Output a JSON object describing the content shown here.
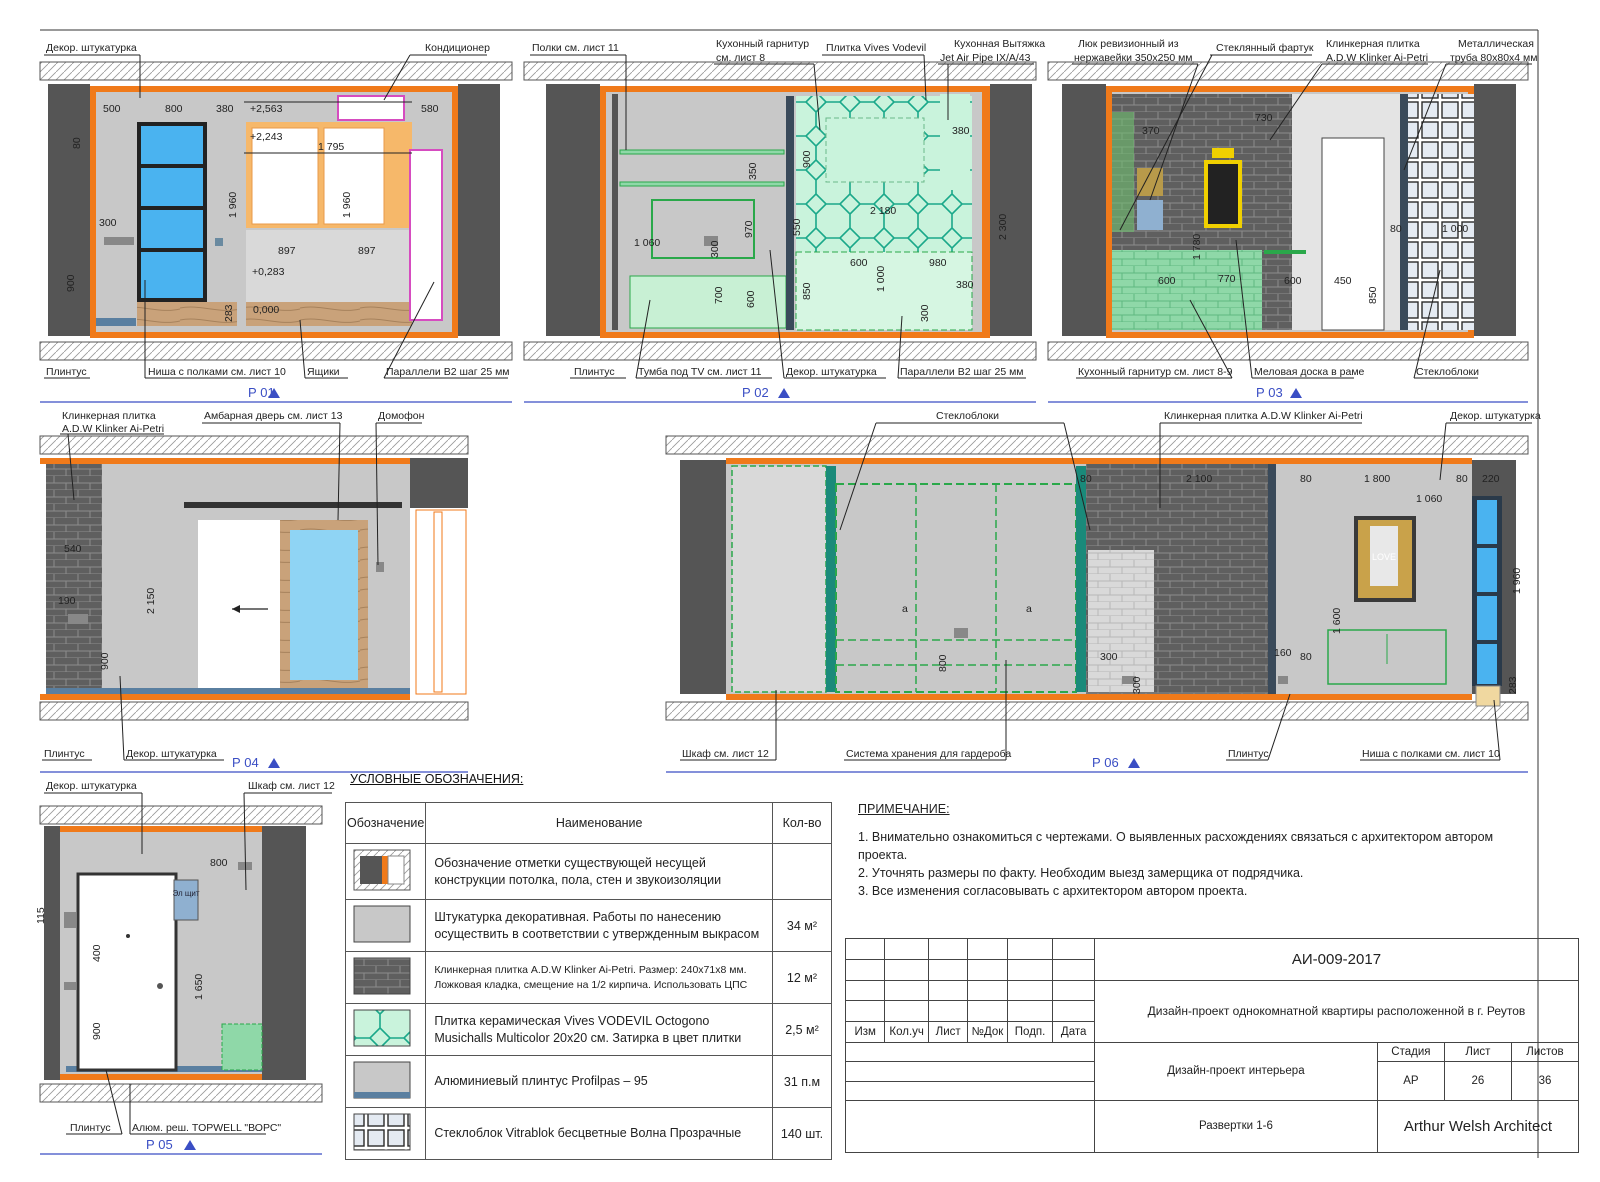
{
  "views": [
    {
      "id": "P 01",
      "title": "Р 01",
      "labels": {
        "top_left": "Декор. штукатурка",
        "top_right": "Кондиционер",
        "b1": "Плинтус",
        "b2": "Ниша с полками см. лист 10",
        "b3": "Ящики",
        "b4": "Параллели B2 шаг 25 мм"
      },
      "dims": [
        "500",
        "800",
        "380",
        "+2,563",
        "+2,243",
        "580",
        "1 795",
        "80",
        "1 960",
        "1 960",
        "300",
        "897",
        "897",
        "+0,283",
        "0,000",
        "900",
        "283"
      ]
    },
    {
      "id": "P 02",
      "title": "Р 02",
      "labels": {
        "t1": "Полки см. лист 11",
        "t2": "Кухонный гарнитур",
        "t2b": "см. лист 8",
        "t3": "Плитка Vives Vodevil",
        "t4": "Кухонная Вытяжка",
        "t4b": "Jet Air Pipe IX/A/43",
        "b1": "Плинтус",
        "b2": "Тумба под TV см. лист 11",
        "b3": "Декор. штукатурка",
        "b4": "Параллели B2 шаг 25 мм"
      },
      "dims": [
        "350",
        "900",
        "380",
        "970",
        "1 060",
        "550",
        "2 180",
        "2 300",
        "300",
        "600",
        "980",
        "1 000",
        "380",
        "700",
        "600",
        "850",
        "300"
      ]
    },
    {
      "id": "P 03",
      "title": "Р 03",
      "labels": {
        "t1": "Люк ревизионный из",
        "t1b": "нержавейки 350x250 мм",
        "t2": "Стеклянный фартук",
        "t3": "Клинкерная плитка",
        "t3b": "A.D.W Klinker Ai-Petri",
        "t4": "Металлическая",
        "t4b": "труба 80x80x4 мм",
        "b1": "Кухонный гарнитур см. лист 8-9",
        "b2": "Меловая доска в раме",
        "b3": "Стеклоблоки"
      },
      "dims": [
        "370",
        "730",
        "1 780",
        "600",
        "770",
        "600",
        "450",
        "80",
        "850",
        "1 000"
      ]
    },
    {
      "id": "P 04",
      "title": "Р 04",
      "labels": {
        "t1": "Клинкерная плитка",
        "t1b": "A.D.W Klinker Ai-Petri",
        "t2": "Амбарная дверь см. лист 13",
        "t3": "Домофон",
        "b1": "Плинтус",
        "b2": "Декор. штукатурка"
      },
      "dims": [
        "540",
        "190",
        "900",
        "2 150"
      ]
    },
    {
      "id": "P 06",
      "title": "Р 06",
      "labels": {
        "t1": "Стеклоблоки",
        "t2": "Клинкерная плитка A.D.W Klinker Ai-Petri",
        "t3": "Декор. штукатурка",
        "b1": "Шкаф см. лист 12",
        "b2": "Система хранения для гардероба",
        "b3": "Плинтус",
        "b4": "Ниша с полками см. лист 10"
      },
      "dims": [
        "80",
        "2 100",
        "80",
        "1 800",
        "80",
        "220",
        "1 060",
        "a",
        "a",
        "800",
        "300",
        "300",
        "1 600",
        "160",
        "80",
        "1 960",
        "283"
      ]
    },
    {
      "id": "P 05",
      "title": "Р 05",
      "labels": {
        "t1": "Декор. штукатурка",
        "t2": "Шкаф см. лист 12",
        "b1": "Плинтус",
        "b2": "Алюм. реш. TOPWELL \"ВОРС\"",
        "panel": "Эл щит"
      },
      "dims": [
        "800",
        "115",
        "400",
        "900",
        "1 650"
      ]
    }
  ],
  "legend": {
    "title": "УСЛОВНЫЕ ОБОЗНАЧЕНИЯ:",
    "headers": [
      "Обозначение",
      "Наименование",
      "Кол-во"
    ],
    "rows": [
      {
        "name": "Обозначение отметки существующей несущей конструкции потолка, пола, стен и звукоизоляции",
        "qty": ""
      },
      {
        "name": "Штукатурка декоративная. Работы по нанесению осуществить в соответствии с утвержденным выкрасом",
        "qty": "34 м²"
      },
      {
        "name": "Клинкерная плитка A.D.W Klinker Ai-Petri. Размер: 240x71x8 мм. Ложковая кладка, смещение на 1/2 кирпича. Использовать ЦПС",
        "qty": "12 м²"
      },
      {
        "name": "Плитка керамическая Vives VODEVIL Octogono Musichalls Multicolor 20x20 см. Затирка в цвет плитки",
        "qty": "2,5 м²"
      },
      {
        "name": "Алюминиевый плинтус Profilpas – 95",
        "qty": "31 п.м"
      },
      {
        "name": "Стеклоблок Vitrablok бесцветные Волна Прозрачные",
        "qty": "140 шт."
      }
    ]
  },
  "notes": {
    "title": "ПРИМЕЧАНИЕ:",
    "items": [
      "1. Внимательно ознакомиться с чертежами. О выявленных расхождениях связаться с архитектором автором проекта.",
      "2. Уточнять размеры по факту. Необходим выезд замерщика от подрядчика.",
      "3. Все изменения согласовывать с архитектором автором проекта."
    ]
  },
  "title_block": {
    "code": "АИ-009-2017",
    "project": "Дизайн-проект однокомнатной квартиры расположенной в г. Реутов",
    "cols": [
      "Изм",
      "Кол.уч",
      "Лист",
      "№Док",
      "Подп.",
      "Дата"
    ],
    "section": "Дизайн-проект интерьера",
    "stage_h": "Стадия",
    "sheet_h": "Лист",
    "sheets_h": "Листов",
    "stage": "АР",
    "sheet": "26",
    "sheets": "36",
    "drawing": "Развертки 1-6",
    "firm": "Arthur Welsh Architect"
  },
  "colors": {
    "plaster": "#c8c8c8",
    "brick": "#5a5a5a",
    "insulation": "#f07a1a",
    "glass": "#4ab3f0",
    "tile": "#7fe0b0",
    "accent": "#3a4ec4"
  },
  "poster_text": "LOVE"
}
